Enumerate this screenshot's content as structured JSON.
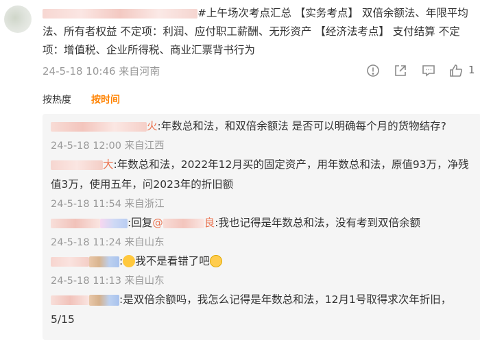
{
  "post": {
    "text": "#上午场次考点汇总 【实务考点】 双倍余额法、年限平均法、所有者权益  不定项：利润、应付职工薪酬、无形资产  【经济法考点】 支付结算 不定项：增值税、企业所得税、商业汇票背书行为",
    "meta": "24-5-18 10:46 来自河南",
    "like_count": "1"
  },
  "icons": {
    "report": "alert-circle-icon",
    "share": "share-icon",
    "comment": "comment-icon",
    "like": "thumbs-up-icon"
  },
  "sort": {
    "by_heat": "按热度",
    "by_time": "按时间"
  },
  "replies": [
    {
      "suffix": "火",
      "text": ":年数总和法，和双倍余额法 是否可以明确每个月的货物结存?",
      "time": "24-5-18 12:00 来自江西"
    },
    {
      "suffix": "大",
      "text": ":年数总和法，2022年12月买的固定资产，用年数总和法，原值93万，净残值3万，使用五年，问2023年的折旧额",
      "time": "24-5-18 11:54 来自浙江"
    },
    {
      "reply_prefix": ":回复",
      "mention_at": "@",
      "mention_suffix": "良",
      "text": ":我也记得是年数总和法，没有考到双倍余额",
      "time": "24-5-18 11:24 来自山东"
    },
    {
      "text_prefix": ":",
      "text": "我不是看错了吧",
      "time": "24-5-18 11:13 来自山东"
    },
    {
      "text": ":是双倍余额吗，我怎么记得是年数总和法，12月1号取得求次年折旧，5/15"
    }
  ]
}
